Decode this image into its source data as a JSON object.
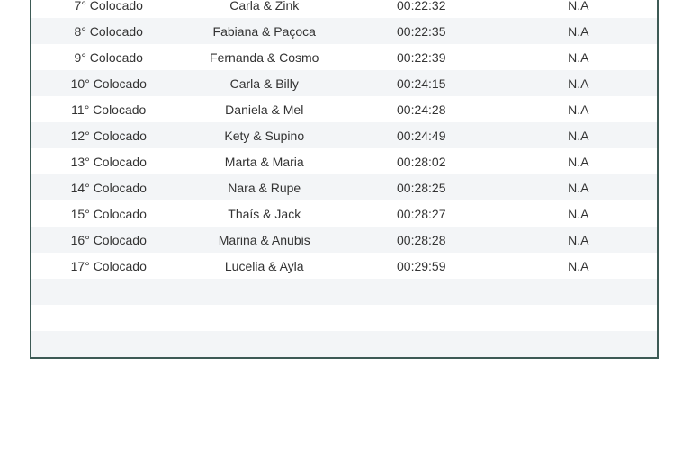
{
  "ranking_table": {
    "rows": [
      {
        "position": "7° Colocado",
        "pair": "Carla & Zink",
        "time": "00:22:32",
        "extra": "N.A"
      },
      {
        "position": "8° Colocado",
        "pair": "Fabiana & Paçoca",
        "time": "00:22:35",
        "extra": "N.A"
      },
      {
        "position": "9° Colocado",
        "pair": "Fernanda & Cosmo",
        "time": "00:22:39",
        "extra": "N.A"
      },
      {
        "position": "10° Colocado",
        "pair": "Carla & Billy",
        "time": "00:24:15",
        "extra": "N.A"
      },
      {
        "position": "11° Colocado",
        "pair": "Daniela & Mel",
        "time": "00:24:28",
        "extra": "N.A"
      },
      {
        "position": "12° Colocado",
        "pair": "Kety & Supino",
        "time": "00:24:49",
        "extra": "N.A"
      },
      {
        "position": "13° Colocado",
        "pair": "Marta & Maria",
        "time": "00:28:02",
        "extra": "N.A"
      },
      {
        "position": "14° Colocado",
        "pair": "Nara & Rupe",
        "time": "00:28:25",
        "extra": "N.A"
      },
      {
        "position": "15° Colocado",
        "pair": "Thaís & Jack",
        "time": "00:28:27",
        "extra": "N.A"
      },
      {
        "position": "16° Colocado",
        "pair": "Marina & Anubis",
        "time": "00:28:28",
        "extra": "N.A"
      },
      {
        "position": "17° Colocado",
        "pair": "Lucelia & Ayla",
        "time": "00:29:59",
        "extra": "N.A"
      },
      {
        "position": "",
        "pair": "",
        "time": "",
        "extra": ""
      },
      {
        "position": "",
        "pair": "",
        "time": "",
        "extra": ""
      },
      {
        "position": "",
        "pair": "",
        "time": "",
        "extra": ""
      }
    ]
  }
}
